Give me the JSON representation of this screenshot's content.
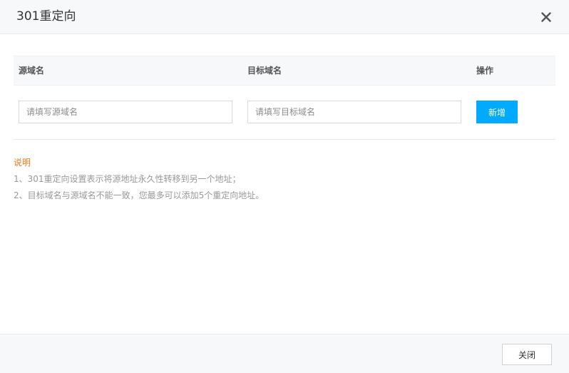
{
  "dialog": {
    "title": "301重定向",
    "close_icon": "close-icon"
  },
  "table": {
    "headers": [
      "源域名",
      "目标域名",
      "操作"
    ],
    "row": {
      "source_placeholder": "请填写源域名",
      "source_value": "",
      "target_placeholder": "请填写目标域名",
      "target_value": "",
      "add_label": "新增"
    }
  },
  "notes": {
    "title": "说明",
    "lines": [
      "1、301重定向设置表示将源地址永久性转移到另一个地址；",
      "2、目标域名与源域名不能一致，您最多可以添加5个重定向地址。"
    ]
  },
  "footer": {
    "close_label": "关闭"
  },
  "colors": {
    "primary": "#00aaff",
    "notes_title": "#f07a19",
    "notes_text": "#999999",
    "header_bg": "#f7f8fa"
  }
}
